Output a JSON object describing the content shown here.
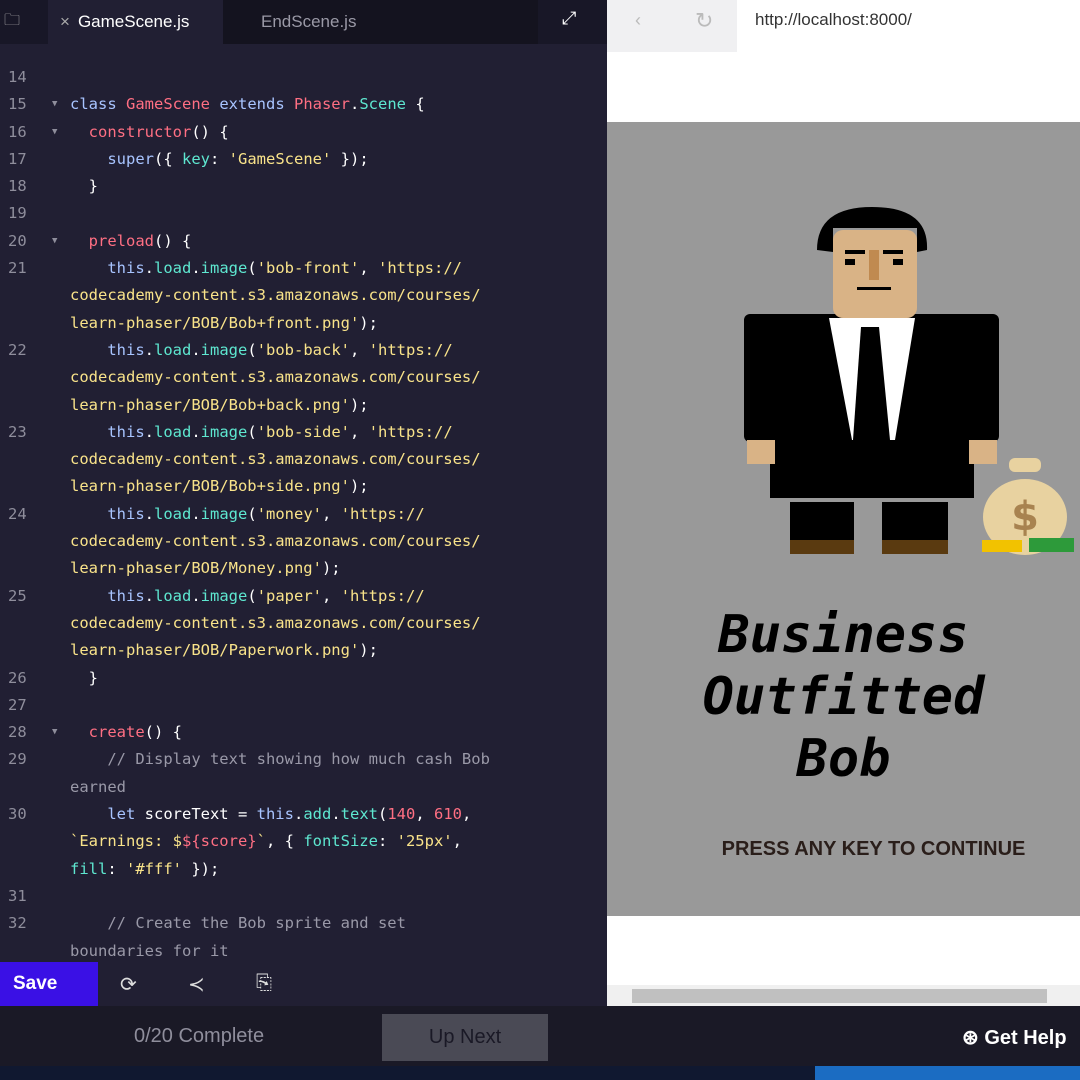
{
  "editor": {
    "tabs": [
      {
        "label": "GameScene.js",
        "close": "×"
      },
      {
        "label": "EndScene.js"
      }
    ],
    "lines": [
      {
        "n": "14",
        "f": false,
        "t": []
      },
      {
        "n": "15",
        "f": true,
        "t": [
          [
            "k",
            "class "
          ],
          [
            "n",
            "GameScene "
          ],
          [
            "k",
            "extends "
          ],
          [
            "n",
            "Phaser"
          ],
          [
            "t",
            "."
          ],
          [
            "p",
            "Scene"
          ],
          [
            "t",
            " {"
          ]
        ]
      },
      {
        "n": "16",
        "f": true,
        "t": [
          [
            "n",
            "  constructor"
          ],
          [
            "t",
            "() {"
          ]
        ]
      },
      {
        "n": "17",
        "f": false,
        "t": [
          [
            "k",
            "    super"
          ],
          [
            "t",
            "({ "
          ],
          [
            "p",
            "key"
          ],
          [
            "t",
            ": "
          ],
          [
            "s",
            "'GameScene'"
          ],
          [
            "t",
            " });"
          ]
        ]
      },
      {
        "n": "18",
        "f": false,
        "t": [
          [
            "t",
            "  }"
          ]
        ]
      },
      {
        "n": "19",
        "f": false,
        "t": []
      },
      {
        "n": "20",
        "f": true,
        "t": [
          [
            "n",
            "  preload"
          ],
          [
            "t",
            "() {"
          ]
        ]
      },
      {
        "n": "21",
        "f": false,
        "t": [
          [
            "k",
            "    this"
          ],
          [
            "t",
            "."
          ],
          [
            "p",
            "load"
          ],
          [
            "t",
            "."
          ],
          [
            "p",
            "image"
          ],
          [
            "t",
            "("
          ],
          [
            "s",
            "'bob-front'"
          ],
          [
            "t",
            ", "
          ],
          [
            "s",
            "'https://"
          ]
        ]
      },
      {
        "n": "",
        "f": false,
        "t": [
          [
            "s",
            "codecademy-content.s3.amazonaws.com/courses/"
          ]
        ]
      },
      {
        "n": "",
        "f": false,
        "t": [
          [
            "s",
            "learn-phaser/BOB/Bob+front.png'"
          ],
          [
            "t",
            ");"
          ]
        ]
      },
      {
        "n": "22",
        "f": false,
        "t": [
          [
            "k",
            "    this"
          ],
          [
            "t",
            "."
          ],
          [
            "p",
            "load"
          ],
          [
            "t",
            "."
          ],
          [
            "p",
            "image"
          ],
          [
            "t",
            "("
          ],
          [
            "s",
            "'bob-back'"
          ],
          [
            "t",
            ", "
          ],
          [
            "s",
            "'https://"
          ]
        ]
      },
      {
        "n": "",
        "f": false,
        "t": [
          [
            "s",
            "codecademy-content.s3.amazonaws.com/courses/"
          ]
        ]
      },
      {
        "n": "",
        "f": false,
        "t": [
          [
            "s",
            "learn-phaser/BOB/Bob+back.png'"
          ],
          [
            "t",
            ");"
          ]
        ]
      },
      {
        "n": "23",
        "f": false,
        "t": [
          [
            "k",
            "    this"
          ],
          [
            "t",
            "."
          ],
          [
            "p",
            "load"
          ],
          [
            "t",
            "."
          ],
          [
            "p",
            "image"
          ],
          [
            "t",
            "("
          ],
          [
            "s",
            "'bob-side'"
          ],
          [
            "t",
            ", "
          ],
          [
            "s",
            "'https://"
          ]
        ]
      },
      {
        "n": "",
        "f": false,
        "t": [
          [
            "s",
            "codecademy-content.s3.amazonaws.com/courses/"
          ]
        ]
      },
      {
        "n": "",
        "f": false,
        "t": [
          [
            "s",
            "learn-phaser/BOB/Bob+side.png'"
          ],
          [
            "t",
            ");"
          ]
        ]
      },
      {
        "n": "24",
        "f": false,
        "t": [
          [
            "k",
            "    this"
          ],
          [
            "t",
            "."
          ],
          [
            "p",
            "load"
          ],
          [
            "t",
            "."
          ],
          [
            "p",
            "image"
          ],
          [
            "t",
            "("
          ],
          [
            "s",
            "'money'"
          ],
          [
            "t",
            ", "
          ],
          [
            "s",
            "'https://"
          ]
        ]
      },
      {
        "n": "",
        "f": false,
        "t": [
          [
            "s",
            "codecademy-content.s3.amazonaws.com/courses/"
          ]
        ]
      },
      {
        "n": "",
        "f": false,
        "t": [
          [
            "s",
            "learn-phaser/BOB/Money.png'"
          ],
          [
            "t",
            ");"
          ]
        ]
      },
      {
        "n": "25",
        "f": false,
        "t": [
          [
            "k",
            "    this"
          ],
          [
            "t",
            "."
          ],
          [
            "p",
            "load"
          ],
          [
            "t",
            "."
          ],
          [
            "p",
            "image"
          ],
          [
            "t",
            "("
          ],
          [
            "s",
            "'paper'"
          ],
          [
            "t",
            ", "
          ],
          [
            "s",
            "'https://"
          ]
        ]
      },
      {
        "n": "",
        "f": false,
        "t": [
          [
            "s",
            "codecademy-content.s3.amazonaws.com/courses/"
          ]
        ]
      },
      {
        "n": "",
        "f": false,
        "t": [
          [
            "s",
            "learn-phaser/BOB/Paperwork.png'"
          ],
          [
            "t",
            ");"
          ]
        ]
      },
      {
        "n": "26",
        "f": false,
        "t": [
          [
            "t",
            "  }"
          ]
        ]
      },
      {
        "n": "27",
        "f": false,
        "t": []
      },
      {
        "n": "28",
        "f": true,
        "t": [
          [
            "n",
            "  create"
          ],
          [
            "t",
            "() {"
          ]
        ]
      },
      {
        "n": "29",
        "f": false,
        "t": [
          [
            "c",
            "    // Display text showing how much cash Bob"
          ]
        ]
      },
      {
        "n": "",
        "f": false,
        "t": [
          [
            "c",
            "earned"
          ]
        ]
      },
      {
        "n": "30",
        "f": false,
        "t": [
          [
            "k",
            "    let "
          ],
          [
            "t",
            "scoreText = "
          ],
          [
            "k",
            "this"
          ],
          [
            "t",
            "."
          ],
          [
            "p",
            "add"
          ],
          [
            "t",
            "."
          ],
          [
            "p",
            "text"
          ],
          [
            "t",
            "("
          ],
          [
            "n",
            "140"
          ],
          [
            "t",
            ", "
          ],
          [
            "n",
            "610"
          ],
          [
            "t",
            ","
          ]
        ]
      },
      {
        "n": "",
        "f": false,
        "t": [
          [
            "s",
            "`Earnings: $"
          ],
          [
            "n",
            "${score}"
          ],
          [
            "s",
            "`"
          ],
          [
            "t",
            ", { "
          ],
          [
            "p",
            "fontSize"
          ],
          [
            "t",
            ": "
          ],
          [
            "s",
            "'25px'"
          ],
          [
            "t",
            ","
          ]
        ]
      },
      {
        "n": "",
        "f": false,
        "t": [
          [
            "p",
            "fill"
          ],
          [
            "t",
            ": "
          ],
          [
            "s",
            "'#fff'"
          ],
          [
            "t",
            " });"
          ]
        ]
      },
      {
        "n": "31",
        "f": false,
        "t": []
      },
      {
        "n": "32",
        "f": false,
        "t": [
          [
            "c",
            "    // Create the Bob sprite and set"
          ]
        ]
      },
      {
        "n": "",
        "f": false,
        "t": [
          [
            "c",
            "boundaries for it"
          ]
        ]
      }
    ]
  },
  "toolbar": {
    "save_label": "Save"
  },
  "browser": {
    "url": "http://localhost:8000/"
  },
  "game": {
    "title_lines": [
      "Business",
      "Outfitted",
      "Bob"
    ],
    "prompt": "PRESS ANY KEY TO CONTINUE",
    "money_symbol": "$"
  },
  "footer": {
    "progress": "0/20 Complete",
    "up_next": "Up Next",
    "help": "Get Help"
  }
}
